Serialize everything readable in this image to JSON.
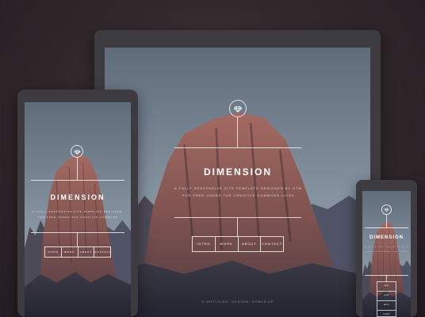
{
  "site": {
    "title": "DIMENSION",
    "tagline_line1": "A FULLY RESPONSIVE SITE TEMPLATE DESIGNED BY HTML5 UP AND RELEASED",
    "tagline_line2": "FOR FREE UNDER THE CREATIVE COMMONS LICENSE",
    "footer": "© UNTITLED. DESIGN: HTML5 UP"
  },
  "nav": [
    {
      "label": "INTRO"
    },
    {
      "label": "WORK"
    },
    {
      "label": "ABOUT"
    },
    {
      "label": "CONTACT"
    }
  ],
  "icons": {
    "logo": "diamond-icon"
  },
  "colors": {
    "background": "#2b2326",
    "device_bezel": "#3e3b40",
    "sky": "#8592a0",
    "rock": "#8a5a55",
    "text": "#ffffff"
  }
}
